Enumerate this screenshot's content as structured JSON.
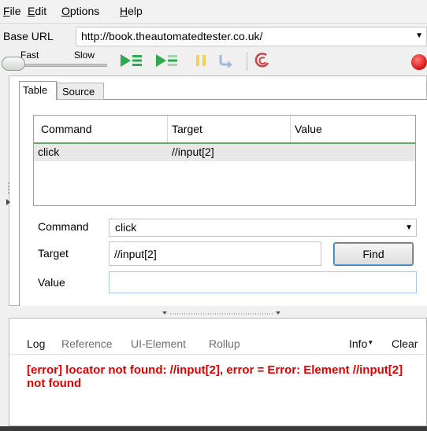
{
  "menubar": {
    "items": [
      {
        "mnemonic": "F",
        "rest": "ile"
      },
      {
        "mnemonic": "E",
        "rest": "dit"
      },
      {
        "mnemonic": "O",
        "rest": "ptions"
      },
      {
        "mnemonic": "H",
        "rest": "elp"
      }
    ]
  },
  "base_url": {
    "label": "Base URL",
    "value": "http://book.theautomatedtester.co.uk/"
  },
  "toolbar": {
    "speed_fast": "Fast",
    "speed_slow": "Slow",
    "buttons": [
      "play-all-icon",
      "play-current-icon",
      "pause-icon",
      "step-icon",
      "rollup-icon",
      "record-icon"
    ],
    "colors": {
      "play": "#2fa84f",
      "pause": "#f0d060",
      "record": "#e02020",
      "rollup": "#d04040"
    }
  },
  "tabs": {
    "table": "Table",
    "source": "Source"
  },
  "grid": {
    "columns": [
      "Command",
      "Target",
      "Value"
    ],
    "rows": [
      {
        "command": "click",
        "target": "//input[2]",
        "value": ""
      }
    ]
  },
  "form": {
    "command_label": "Command",
    "command_value": "click",
    "target_label": "Target",
    "target_value": "//input[2]",
    "find_label": "Find",
    "value_label": "Value",
    "value_value": ""
  },
  "log": {
    "tabs": {
      "log": "Log",
      "reference": "Reference",
      "ui_element": "UI-Element",
      "rollup": "Rollup"
    },
    "info": "Info",
    "clear": "Clear",
    "message": "[error] locator not found: //input[2], error = Error: Element //input[2] not found",
    "message_color": "#e00000"
  }
}
